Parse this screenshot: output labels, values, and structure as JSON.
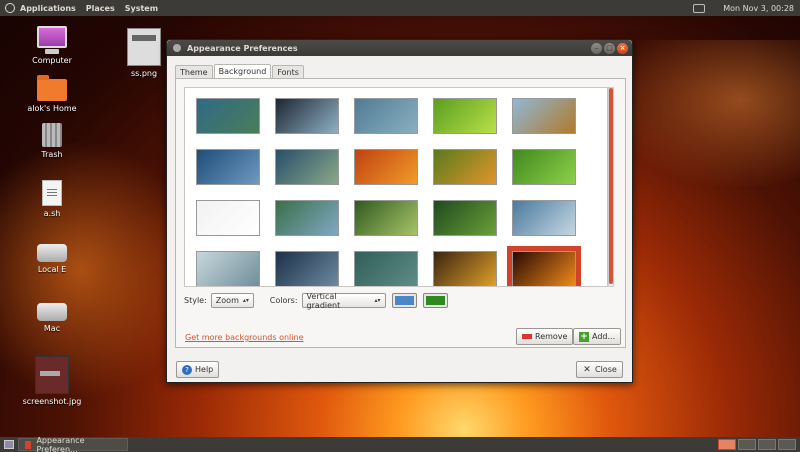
{
  "top_panel": {
    "menus": [
      "Applications",
      "Places",
      "System"
    ],
    "clock": "Mon Nov  3, 00:28"
  },
  "desktop_icons": [
    "Computer",
    "alok's Home",
    "Trash",
    "a.sh",
    "Local E",
    "Mac",
    "ss.png",
    "screenshot.jpg"
  ],
  "window": {
    "title": "Appearance Preferences",
    "tabs": [
      "Theme",
      "Background",
      "Fonts"
    ],
    "style_label": "Style:",
    "style_value": "Zoom",
    "colors_label": "Colors:",
    "colors_value": "Vertical gradient",
    "primary_color": "#4a87c9",
    "secondary_color": "#2c8a1e",
    "link_label": "Get more backgrounds online",
    "remove_label": "Remove",
    "add_label": "Add...",
    "help_label": "Help",
    "close_label": "Close"
  },
  "wallpapers": [
    {
      "name": "wallpaper-1",
      "colors": [
        "#2f6a86",
        "#4a7d5a"
      ]
    },
    {
      "name": "wallpaper-2",
      "colors": [
        "#1c2733",
        "#8fb1c6"
      ]
    },
    {
      "name": "wallpaper-3",
      "colors": [
        "#4f7c94",
        "#8ab0c0"
      ]
    },
    {
      "name": "wallpaper-4",
      "colors": [
        "#5a9e1e",
        "#b9e04a"
      ]
    },
    {
      "name": "wallpaper-5",
      "colors": [
        "#8fb8d6",
        "#b07a2a"
      ]
    },
    {
      "name": "wallpaper-6",
      "colors": [
        "#1f4d7a",
        "#6e9ac0"
      ]
    },
    {
      "name": "wallpaper-7",
      "colors": [
        "#274f6b",
        "#8ba88a"
      ]
    },
    {
      "name": "wallpaper-8",
      "colors": [
        "#c0420f",
        "#f29b2a"
      ]
    },
    {
      "name": "wallpaper-9",
      "colors": [
        "#5a7a1e",
        "#e0962a"
      ]
    },
    {
      "name": "wallpaper-10",
      "colors": [
        "#3f8a1e",
        "#8fd04a"
      ]
    },
    {
      "name": "wallpaper-11",
      "colors": [
        "#f2f2f2",
        "#ffffff"
      ]
    },
    {
      "name": "wallpaper-12",
      "colors": [
        "#3b6f4a",
        "#7fa8c4"
      ]
    },
    {
      "name": "wallpaper-13",
      "colors": [
        "#2f5a1e",
        "#a8c46a"
      ]
    },
    {
      "name": "wallpaper-14",
      "colors": [
        "#1e4a1e",
        "#6aa03a"
      ]
    },
    {
      "name": "wallpaper-15",
      "colors": [
        "#4a7a9e",
        "#c6d8e2"
      ]
    },
    {
      "name": "wallpaper-16",
      "colors": [
        "#c8d6dc",
        "#6f8f9a"
      ]
    },
    {
      "name": "wallpaper-17",
      "colors": [
        "#1c3148",
        "#6c8aa0"
      ]
    },
    {
      "name": "wallpaper-18",
      "colors": [
        "#2f5f5a",
        "#5e8c86"
      ]
    },
    {
      "name": "wallpaper-19",
      "colors": [
        "#3a2410",
        "#e0a02a"
      ]
    },
    {
      "name": "wallpaper-20",
      "colors": [
        "#2a0a04",
        "#f08a1a"
      ],
      "selected": true
    }
  ],
  "taskbar": {
    "task_label": "Appearance Preferen..."
  }
}
